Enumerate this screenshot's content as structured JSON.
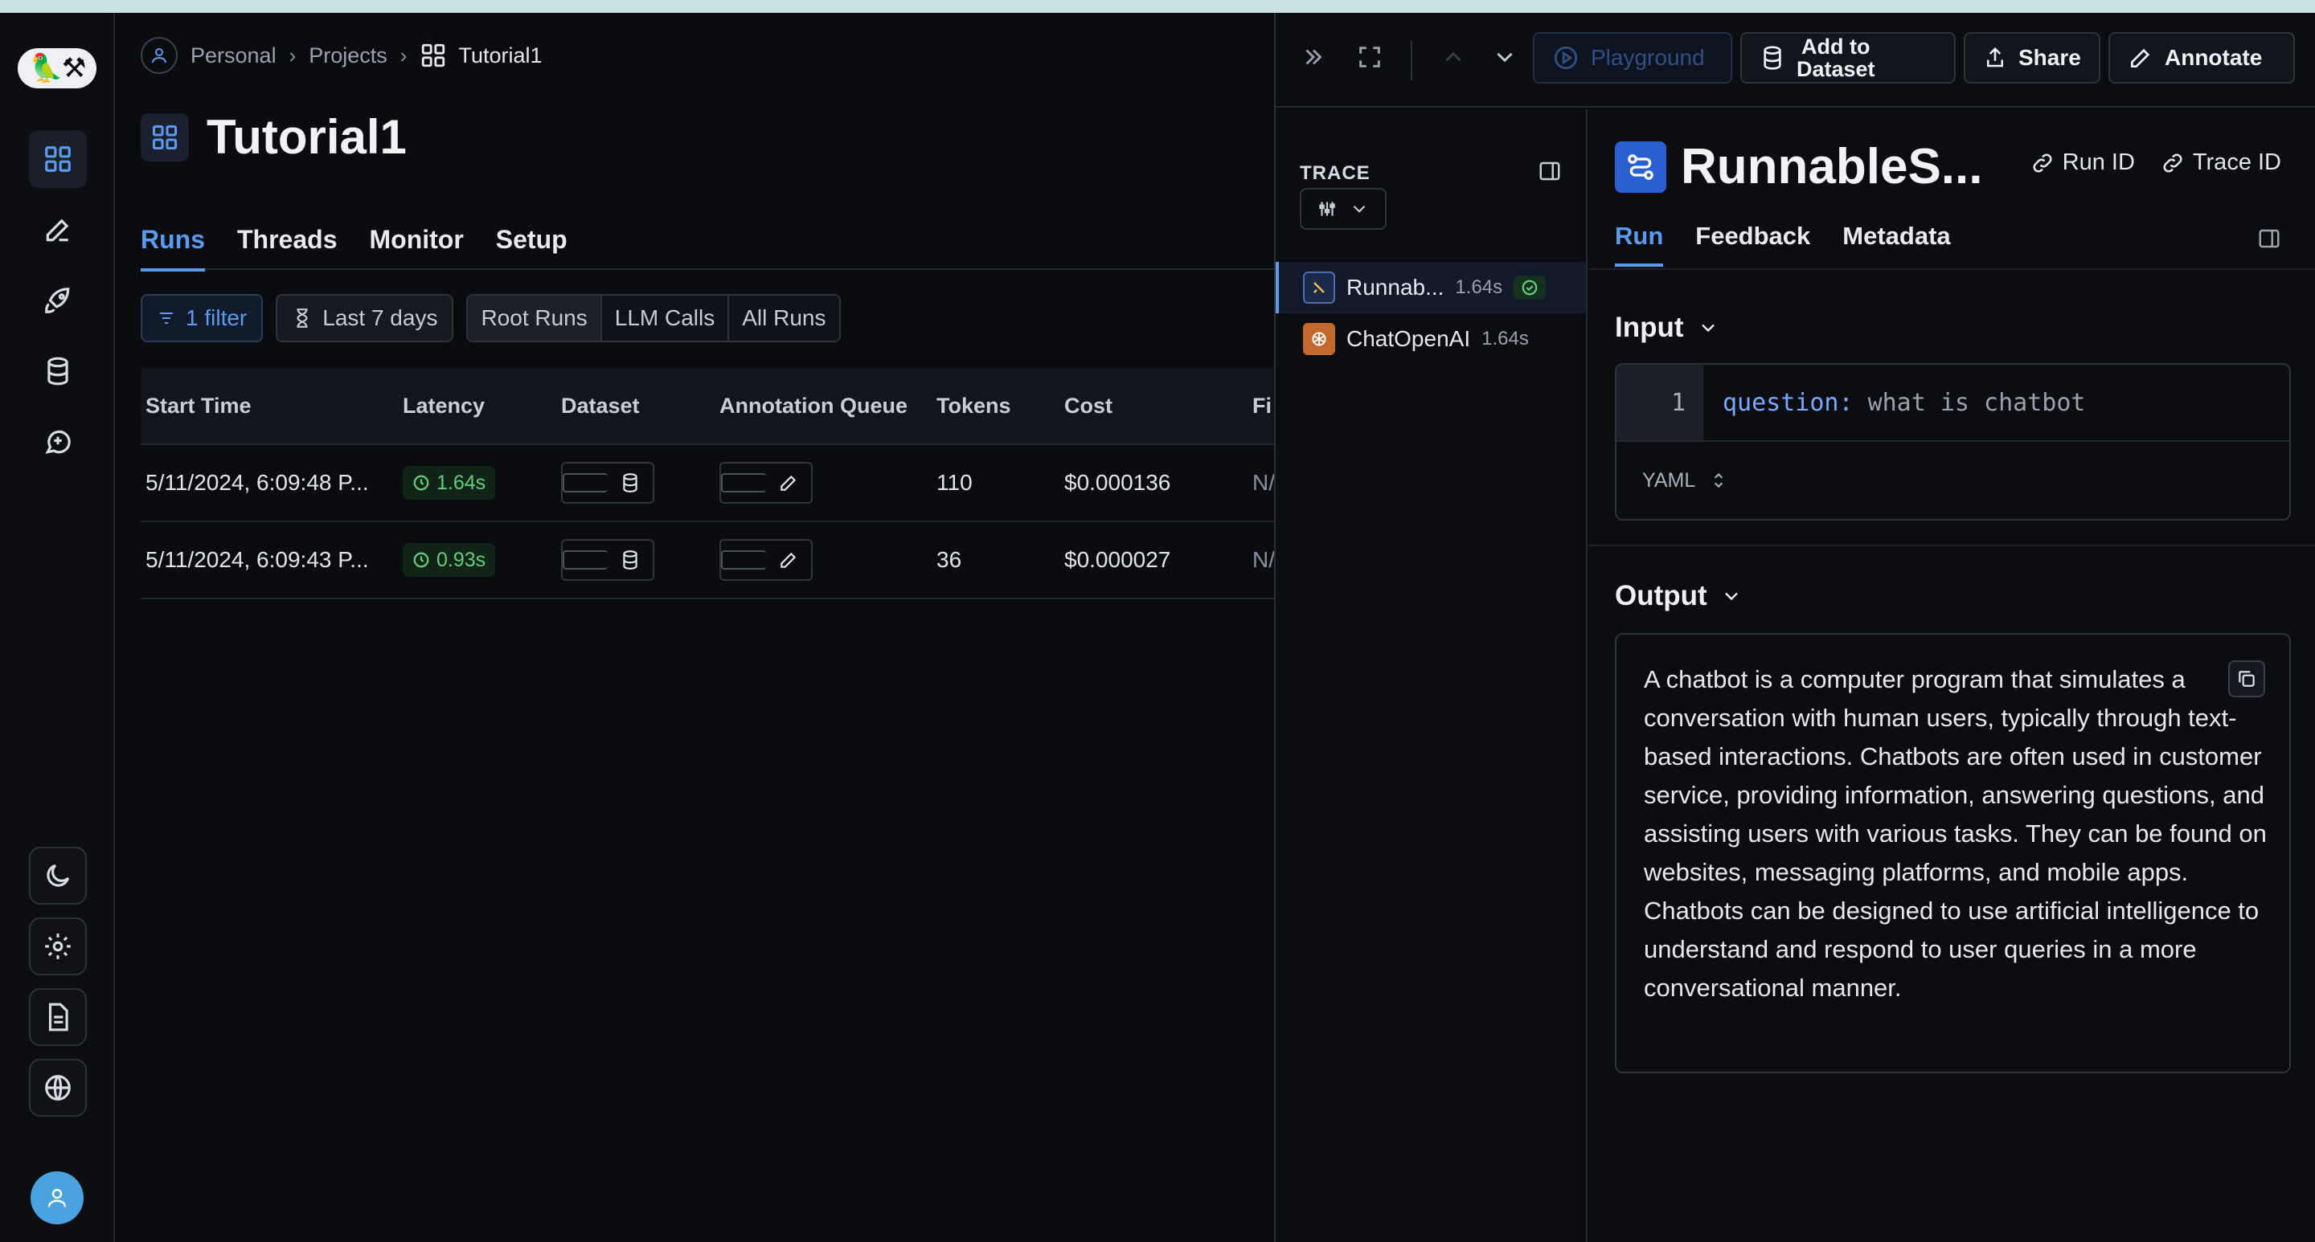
{
  "breadcrumb": {
    "personal": "Personal",
    "projects": "Projects",
    "current": "Tutorial1"
  },
  "page": {
    "title": "Tutorial1"
  },
  "tabs": [
    {
      "label": "Runs"
    },
    {
      "label": "Threads"
    },
    {
      "label": "Monitor"
    },
    {
      "label": "Setup"
    }
  ],
  "filters": {
    "filter_label": "1 filter",
    "date_label": "Last 7 days",
    "run_types": [
      {
        "label": "Root Runs"
      },
      {
        "label": "LLM Calls"
      },
      {
        "label": "All Runs"
      }
    ]
  },
  "table": {
    "columns": [
      "Start Time",
      "Latency",
      "Dataset",
      "Annotation Queue",
      "Tokens",
      "Cost",
      "Fi"
    ],
    "rows": [
      {
        "start_time": "5/11/2024, 6:09:48 P...",
        "latency": "1.64s",
        "tokens": "110",
        "cost": "$0.000136",
        "first_token": "N/"
      },
      {
        "start_time": "5/11/2024, 6:09:43 P...",
        "latency": "0.93s",
        "tokens": "36",
        "cost": "$0.000027",
        "first_token": "N/"
      }
    ]
  },
  "toolbar": {
    "playground": "Playground",
    "add_to_dataset_1": "Add to",
    "add_to_dataset_2": "Dataset",
    "share": "Share",
    "annotate": "Annotate"
  },
  "trace": {
    "label": "TRACE",
    "items": [
      {
        "name": "Runnab...",
        "time": "1.64s"
      },
      {
        "name": "ChatOpenAI",
        "time": "1.64s"
      }
    ]
  },
  "detail": {
    "title": "RunnableS...",
    "run_id": "Run ID",
    "trace_id": "Trace ID",
    "tabs": [
      {
        "label": "Run"
      },
      {
        "label": "Feedback"
      },
      {
        "label": "Metadata"
      }
    ],
    "input_label": "Input",
    "input_line_number": "1",
    "input_key": "question:",
    "input_value": "what is chatbot",
    "format": "YAML",
    "output_label": "Output",
    "output_text": "A chatbot is a computer program that simulates a conversation with human users, typically through text-based interactions. Chatbots are often used in customer service, providing information, answering questions, and assisting users with various tasks. They can be found on websites, messaging platforms, and mobile apps. Chatbots can be designed to use artificial intelligence to understand and respond to user queries in a more conversational manner."
  },
  "colors": {
    "accent": "#5a9bf0",
    "success": "#5fd17a",
    "background": "#0b0c10"
  }
}
